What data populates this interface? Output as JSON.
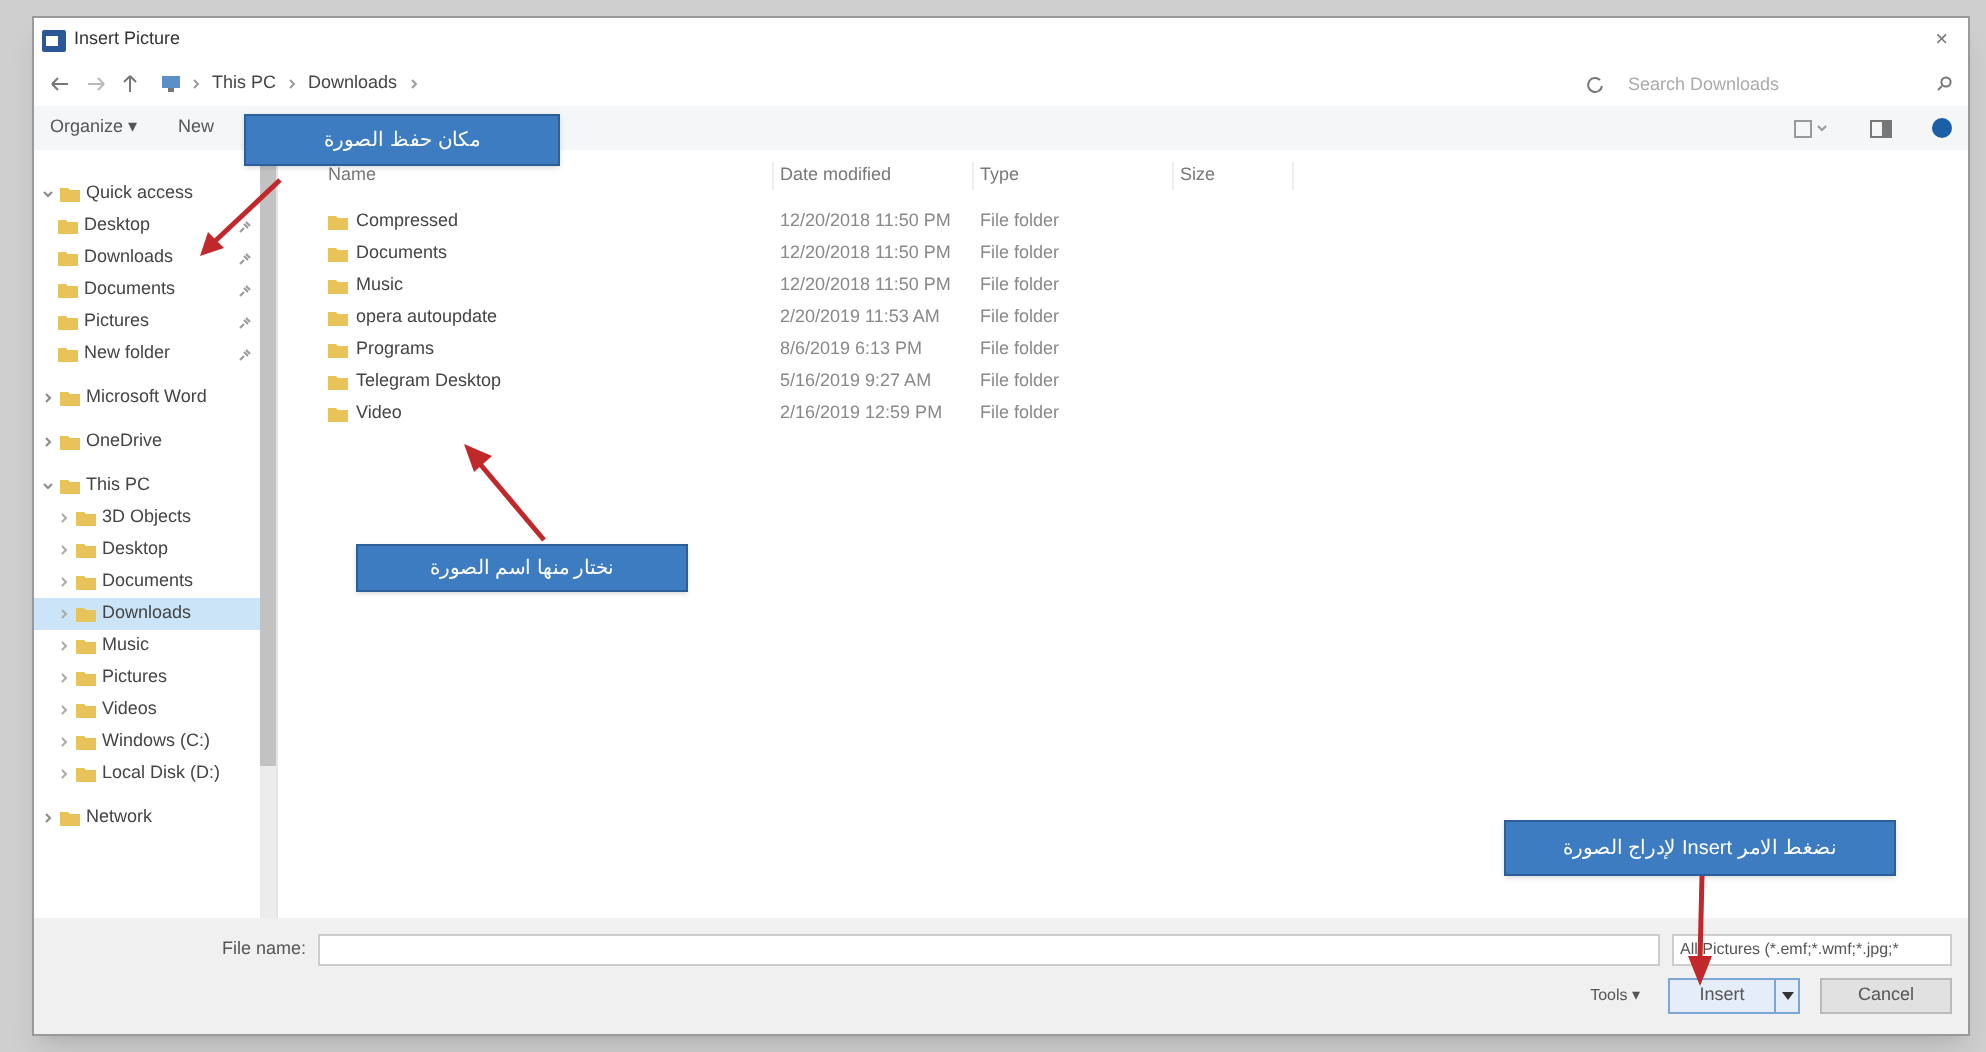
{
  "window": {
    "title": "Insert Picture",
    "close": "×"
  },
  "address": {
    "crumbs": [
      "This PC",
      "Downloads"
    ],
    "search_placeholder": "Search Downloads"
  },
  "toolbar": {
    "buttons": [
      "Organize ▾",
      "New"
    ]
  },
  "nav": [
    {
      "label": "Quick access",
      "expanded": true,
      "selected": false,
      "children": [
        {
          "label": "Desktop",
          "pinned": true,
          "selected": false
        },
        {
          "label": "Downloads",
          "pinned": true,
          "selected": false
        },
        {
          "label": "Documents",
          "pinned": true,
          "selected": false
        },
        {
          "label": "Pictures",
          "pinned": true,
          "selected": false
        },
        {
          "label": "New folder",
          "pinned": true,
          "selected": false
        }
      ]
    },
    {
      "label": "Microsoft Word",
      "expanded": false,
      "selected": false
    },
    {
      "label": "OneDrive",
      "expanded": false,
      "selected": false
    },
    {
      "label": "This PC",
      "expanded": true,
      "selected": false,
      "children": [
        {
          "label": "3D Objects",
          "selected": false
        },
        {
          "label": "Desktop",
          "selected": false
        },
        {
          "label": "Documents",
          "selected": false
        },
        {
          "label": "Downloads",
          "selected": true
        },
        {
          "label": "Music",
          "selected": false
        },
        {
          "label": "Pictures",
          "selected": false
        },
        {
          "label": "Videos",
          "selected": false
        },
        {
          "label": "Windows (C:)",
          "selected": false
        },
        {
          "label": "Local Disk (D:)",
          "selected": false
        }
      ]
    },
    {
      "label": "Network",
      "expanded": false,
      "selected": false
    }
  ],
  "table": {
    "columns": [
      "Name",
      "Date modified",
      "Type",
      "Size"
    ],
    "rows": [
      {
        "name": "Compressed",
        "date": "12/20/2018 11:50 PM",
        "type": "File folder"
      },
      {
        "name": "Documents",
        "date": "12/20/2018 11:50 PM",
        "type": "File folder"
      },
      {
        "name": "Music",
        "date": "12/20/2018 11:50 PM",
        "type": "File folder"
      },
      {
        "name": "opera autoupdate",
        "date": "2/20/2019 11:53 AM",
        "type": "File folder"
      },
      {
        "name": "Programs",
        "date": "8/6/2019 6:13 PM",
        "type": "File folder"
      },
      {
        "name": "Telegram Desktop",
        "date": "5/16/2019 9:27 AM",
        "type": "File folder"
      },
      {
        "name": "Video",
        "date": "2/16/2019 12:59 PM",
        "type": "File folder"
      }
    ]
  },
  "footer": {
    "file_name_label": "File name:",
    "filter": "All Pictures (*.emf;*.wmf;*.jpg;*",
    "tools": "Tools ▾",
    "insert": "Insert",
    "cancel": "Cancel"
  },
  "callouts": [
    {
      "text": "مكان حفظ الصورة"
    },
    {
      "text": "نختار منها اسم الصورة"
    },
    {
      "text": "نضغط الامر Insert لإدراج الصورة"
    }
  ]
}
